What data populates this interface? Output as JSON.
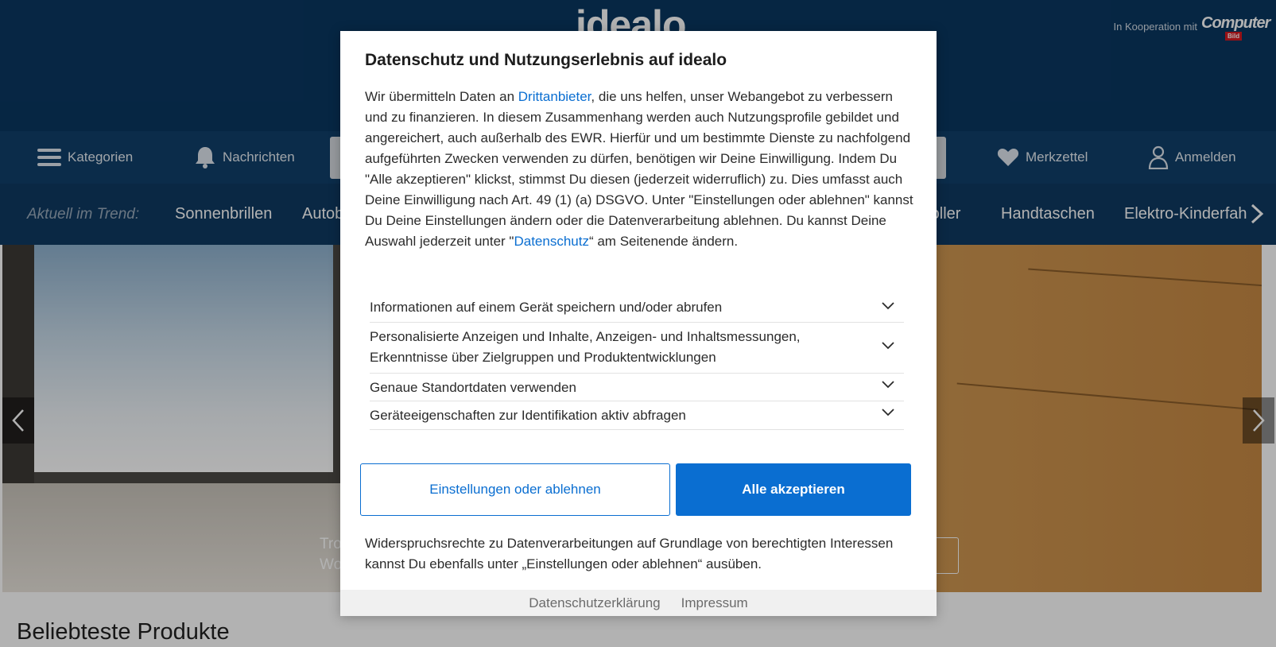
{
  "header": {
    "logo": "idealo",
    "cooperation_text": "In Kooperation mit",
    "partner_logo": "Computer",
    "partner_logo_sub": "Bild"
  },
  "nav": {
    "categories_label": "Kategorien",
    "notifications_label": "Nachrichten",
    "wishlist_label": "Merkzettel",
    "login_label": "Anmelden"
  },
  "trend": {
    "label": "Aktuell im Trend:",
    "items": [
      "Sonnenbrillen",
      "Autob",
      "roller",
      "Handtaschen",
      "Elektro-Kinderfah"
    ]
  },
  "hero": {
    "caption_line1": "Tro",
    "caption_line2": "Wo"
  },
  "section": {
    "title": "Beliebteste Produkte"
  },
  "consent": {
    "title": "Datenschutz und Nutzungserlebnis auf idealo",
    "intro_before_link": "Wir übermitteln Daten an ",
    "link_third_party": "Drittanbieter",
    "intro_after_link": ", die uns helfen, unser Webangebot zu verbessern und zu finanzieren. In diesem Zusammenhang werden auch Nutzungsprofile gebildet und angereichert, auch außerhalb des EWR. Hierfür und um bestimmte Dienste zu nachfolgend aufgeführten Zwecken verwenden zu dürfen, benötigen wir Deine Einwilligung. Indem Du \"Alle akzeptieren\" klickst, stimmst Du diesen (jederzeit widerruflich) zu. Dies umfasst auch Deine Einwilligung nach Art. 49 (1) (a) DSGVO. Unter \"Einstellungen oder ablehnen\" kannst Du Deine Einstellungen ändern oder die Datenverarbeitung ablehnen. Du kannst Deine Auswahl jederzeit unter \"",
    "link_privacy": "Datenschutz",
    "intro_end": "“ am Seitenende ändern.",
    "purposes": [
      "Informationen auf einem Gerät speichern und/oder abrufen",
      "Personalisierte Anzeigen und Inhalte, Anzeigen- und Inhaltsmessungen, Erkenntnisse über Zielgruppen und Produktentwicklungen",
      "Genaue Standortdaten verwenden",
      "Geräteeigenschaften zur Identifikation aktiv abfragen"
    ],
    "settings_button": "Einstellungen oder ablehnen",
    "accept_button": "Alle akzeptieren",
    "objection_text": "Widerspruchsrechte zu Datenverarbeitungen auf Grundlage von berechtigten Interessen kannst Du ebenfalls unter „Einstellungen oder ablehnen“ ausüben.",
    "footer_privacy_link": "Datenschutzerklärung",
    "footer_imprint_link": "Impressum"
  },
  "colors": {
    "header_bg": "#0a3761",
    "accent": "#0a6ed1"
  }
}
